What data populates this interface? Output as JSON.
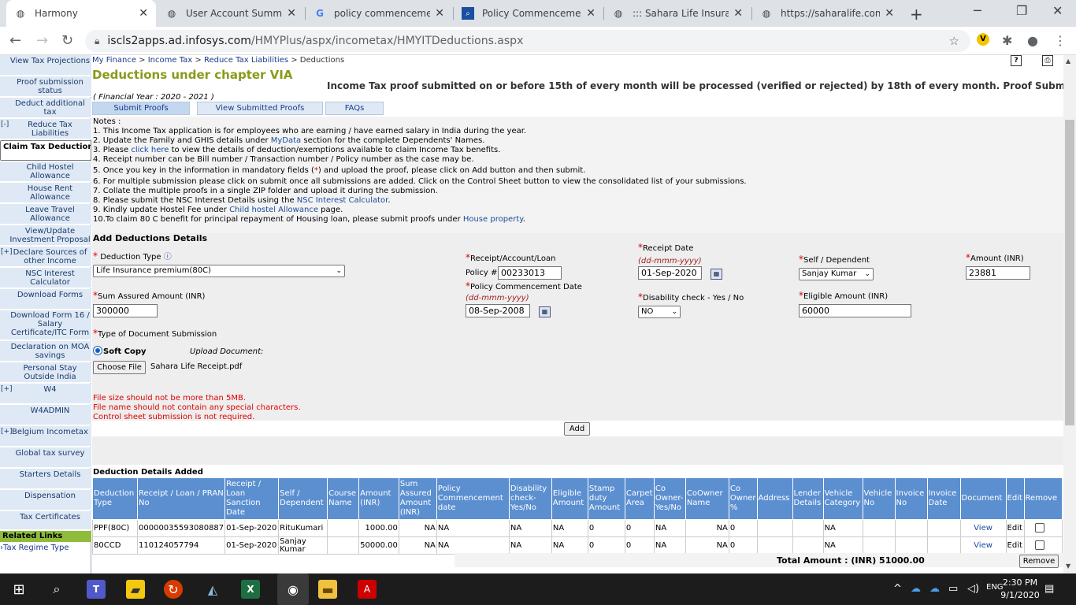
{
  "browser": {
    "tabs": [
      {
        "title": "Harmony",
        "icon": "globe-icon"
      },
      {
        "title": "User Account Summary",
        "icon": "globe-icon"
      },
      {
        "title": "policy commencement",
        "icon": "google-icon"
      },
      {
        "title": "Policy Commencement",
        "icon": "search-doc-icon"
      },
      {
        "title": "::: Sahara Life Insurance",
        "icon": "globe-icon"
      },
      {
        "title": "https://saharalife.com/",
        "icon": "globe-icon"
      }
    ],
    "url_domain": "iscls2apps.ad.infosys.com",
    "url_path": "/HMYPlus/aspx/incometax/HMYITDeductions.aspx"
  },
  "sidebar": {
    "items": [
      {
        "label": "View Tax Projections",
        "plus": ""
      },
      {
        "label": "Proof submission status",
        "plus": ""
      },
      {
        "label": "Deduct additional tax",
        "plus": ""
      },
      {
        "label": "Reduce Tax Liabilities",
        "plus": "[-]"
      },
      {
        "label": "Claim Tax Deductions",
        "plus": ""
      },
      {
        "label": "Child Hostel Allowance",
        "plus": ""
      },
      {
        "label": "House Rent Allowance",
        "plus": ""
      },
      {
        "label": "Leave Travel Allowance",
        "plus": ""
      },
      {
        "label": "View/Update Investment Proposal",
        "plus": ""
      },
      {
        "label": "Declare Sources of other Income",
        "plus": "[+]"
      },
      {
        "label": "NSC Interest Calculator",
        "plus": ""
      },
      {
        "label": "Download Forms",
        "plus": ""
      },
      {
        "label": "Download Form 16 / Salary Certificate/ITC Form",
        "plus": ""
      },
      {
        "label": "Declaration on MOA savings",
        "plus": ""
      },
      {
        "label": "Personal Stay Outside India",
        "plus": ""
      },
      {
        "label": "W4",
        "plus": "[+]"
      },
      {
        "label": "W4ADMIN",
        "plus": ""
      },
      {
        "label": "Belgium Incometax",
        "plus": "[+]"
      },
      {
        "label": "Global tax survey",
        "plus": ""
      },
      {
        "label": "Starters Details",
        "plus": ""
      },
      {
        "label": "Dispensation",
        "plus": ""
      },
      {
        "label": "Tax Certificates",
        "plus": ""
      }
    ],
    "related_links": "Related Links",
    "tax_regime": "Tax Regime Type"
  },
  "breadcrumb": {
    "a": "My Finance",
    "b": "Income Tax",
    "c": "Reduce Tax Liabilities",
    "d": "Deductions",
    "sep": " > "
  },
  "page_title": "Deductions under chapter VIA",
  "banner": "Income Tax proof submitted on or before 15th of every month will be processed (verified or rejected) by 18th of every month. Proof Submitted after said cut off date:",
  "financial_year": "( Financial Year : 2020 - 2021 )",
  "subtabs": [
    "Submit Proofs",
    "View Submitted Proofs",
    "FAQs"
  ],
  "notes": {
    "heading": "Notes :",
    "n1": "1.  This Income Tax application is for employees who are earning / have earned salary in India during the year.",
    "n2a": "2.  Update the Family and GHIS details under ",
    "n2link": "MyData",
    "n2b": " section for the complete Dependents' Names.",
    "n3a": "3.  Please ",
    "n3link": "click here",
    "n3b": " to view the details of deduction/exemptions available to claim Income Tax benefits.",
    "n4": "4.  Receipt number can be Bill number / Transaction number / Policy number as the case may be.",
    "n5a": "5.  Once you key in the information in mandatory fields (",
    "n5star": "*",
    "n5b": ") and upload the proof, please click on Add button and then submit.",
    "n6": "6.  For multiple submission please click on submit once all submissions are added. Click on the Control Sheet button to view the consolidated list of your submissions.",
    "n7": "7.  Collate the multiple proofs in a single ZIP folder and upload it during the submission.",
    "n8a": "8.  Please submit the NSC Interest Details using the ",
    "n8link": "NSC Interest Calculator",
    "n8b": ".",
    "n9a": "9.  Kindly update Hostel Fee under ",
    "n9link": "Child hostel Allowance",
    "n9b": " page.",
    "n10a": "10.To claim 80 C benefit for principal repayment of Housing loan, please submit proofs under ",
    "n10link": "House property",
    "n10b": "."
  },
  "form": {
    "section_title": "Add Deductions Details",
    "star": "*",
    "deduction_type_label": "Deduction Type",
    "info_icon": "ⓘ",
    "deduction_type_value": "Life Insurance premium(80C)",
    "receipt_label": "Receipt/Account/Loan",
    "policy_prefix": "Policy #",
    "receipt_value": "00233013",
    "receipt_date_label": "Receipt Date",
    "date_hint": "(dd-mmm-yyyy)",
    "receipt_date_value": "01-Sep-2020",
    "self_dep_label": "Self / Dependent",
    "self_dep_value": "Sanjay Kumar",
    "amount_label": "Amount (INR)",
    "amount_value": "23881",
    "sum_assured_label": "Sum Assured Amount (INR)",
    "sum_assured_value": "300000",
    "policy_comm_label": "Policy Commencement Date",
    "policy_comm_value": "08-Sep-2008",
    "disability_label": "Disability check - Yes / No",
    "disability_value": "NO",
    "eligible_label": "Eligible Amount (INR)",
    "eligible_value": "60000",
    "doc_type_label": "Type of Document Submission",
    "soft_copy": "Soft Copy",
    "upload_label": "Upload Document:",
    "choose_file": "Choose File",
    "file_name": "Sahara Life Receipt.pdf",
    "err1": "File size should not be more than 5MB.",
    "err2": "File name should not contain any special characters.",
    "err3": "Control sheet submission is not required.",
    "add_button": "Add"
  },
  "table": {
    "title": "Deduction Details Added",
    "headers": [
      "Deduction Type",
      "Receipt / Loan / PRAN No",
      "Receipt / Loan Sanction Date",
      "Self / Dependent",
      "Course Name",
      "Amount (INR)",
      "Sum Assured Amount (INR)",
      "Policy Commencement date",
      "Disability check-Yes/No",
      "Eligible Amount",
      "Stamp duty Amount",
      "Carpet Area",
      "Co Owner-Yes/No",
      "CoOwner Name",
      "Co Owner %",
      "Address",
      "Lender Details",
      "Vehicle Category",
      "Vehicle No",
      "Invoice No",
      "Invoice Date",
      "Document",
      "Edit",
      "Remove"
    ],
    "rows": [
      [
        "PPF(80C)",
        "00000035593080887",
        "01-Sep-2020",
        "RituKumari",
        "",
        "1000.00",
        "NA",
        "NA",
        "NA",
        "NA",
        "0",
        "0",
        "NA",
        "NA",
        "0",
        "",
        "",
        "NA",
        "",
        "",
        "",
        "View",
        "Edit",
        ""
      ],
      [
        "80CCD",
        "110124057794",
        "01-Sep-2020",
        "Sanjay Kumar",
        "",
        "50000.00",
        "NA",
        "NA",
        "NA",
        "NA",
        "0",
        "0",
        "NA",
        "NA",
        "0",
        "",
        "",
        "NA",
        "",
        "",
        "",
        "View",
        "Edit",
        ""
      ]
    ],
    "total": "Total Amount : (INR) 51000.00",
    "remove_button": "Remove"
  },
  "taskbar": {
    "time": "2:30 PM",
    "date": "9/1/2020"
  }
}
